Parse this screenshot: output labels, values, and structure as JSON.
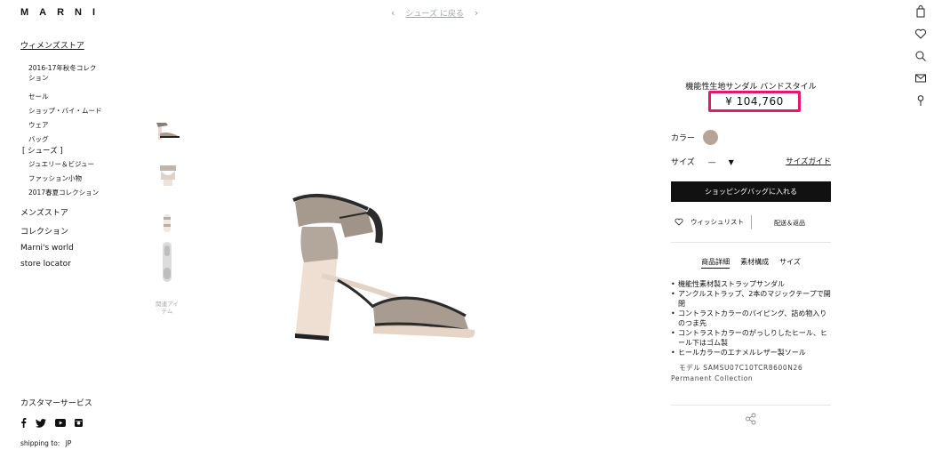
{
  "header": {
    "logo": "MARNI",
    "back_link": "シューズ に戻る"
  },
  "icons": [
    "shopping-bag-icon",
    "heart-icon",
    "search-icon",
    "mail-icon",
    "location-pin-icon"
  ],
  "sidebar": {
    "womens_store": "ウィメンズストア",
    "sub_items": [
      "2016-17年秋冬コレクション",
      "セール",
      "ショップ・バイ・ムード",
      "ウェア",
      "バッグ",
      "[ シューズ ]",
      "ジュエリー＆ビジュー",
      "ファッション小物",
      "2017春夏コレクション"
    ],
    "mens_store": "メンズストア",
    "collection": "コレクション",
    "marnis_world": "Marni's world",
    "store_locator": "store locator"
  },
  "footer": {
    "customer_service": "カスタマーサービス",
    "shipping_label": "shipping to:",
    "shipping_country": "JP",
    "social": [
      "facebook-icon",
      "twitter-icon",
      "youtube-icon",
      "instagram-icon"
    ]
  },
  "gallery": {
    "related_items": "関連アイテム"
  },
  "product": {
    "title": "機能性生地サンダル バンドスタイル",
    "price": "¥ 104,760",
    "color_label": "カラー",
    "color_hex": "#b6a597",
    "size_label": "サイズ",
    "size_value": "—",
    "size_guide": "サイズガイド",
    "add_to_bag": "ショッピングバッグに入れる",
    "wishlist": "ウィッシュリスト",
    "shipping_returns": "配送＆返品",
    "tabs": [
      "商品詳細",
      "素材構成",
      "サイズ"
    ],
    "details": [
      "機能性素材製ストラップサンダル",
      "アンクルストラップ、2本のマジックテープで開閉",
      "コントラストカラーのパイピング、詰め物入りのつま先",
      "コントラストカラーのがっしりしたヒール、ヒール下はゴム製",
      "ヒールカラーのエナメルレザー製ソール"
    ],
    "model_line": "モデル SAMSU07C10TCR8600N26",
    "collection_line": "Permanent Collection"
  },
  "colors": {
    "highlight": "#e01a6c",
    "button": "#111111"
  }
}
